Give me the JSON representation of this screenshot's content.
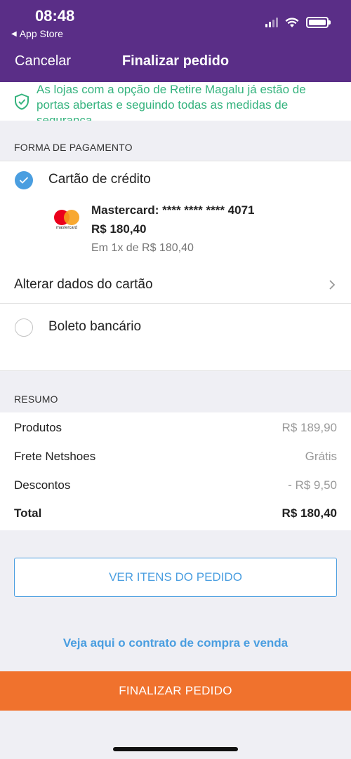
{
  "status_bar": {
    "time": "08:48",
    "back_app": "App Store"
  },
  "nav": {
    "cancel": "Cancelar",
    "title": "Finalizar pedido"
  },
  "banner": {
    "text": "As lojas com a opção de Retire Magalu já estão de portas abertas e seguindo todas as medidas de segurança"
  },
  "payment": {
    "section_label": "FORMA DE PAGAMENTO",
    "credit_option": "Cartão de crédito",
    "card_name": "Mastercard: **** **** **** 4071",
    "card_amount": "R$ 180,40",
    "installments": "Em 1x de R$ 180,40",
    "card_logo_text": "mastercard",
    "alter_card": "Alterar dados do cartão",
    "boleto_option": "Boleto bancário"
  },
  "summary": {
    "section_label": "RESUMO",
    "rows": [
      {
        "label": "Produtos",
        "value": "R$ 189,90"
      },
      {
        "label": "Frete Netshoes",
        "value": "Grátis"
      },
      {
        "label": "Descontos",
        "value": "- R$ 9,50"
      },
      {
        "label": "Total",
        "value": "R$ 180,40"
      }
    ]
  },
  "actions": {
    "view_items": "VER ITENS DO PEDIDO",
    "contract_link": "Veja aqui o contrato de compra e venda",
    "finish": "FINALIZAR PEDIDO"
  },
  "colors": {
    "header": "#5a2e87",
    "accent": "#4a9ee0",
    "finish": "#f0722d",
    "banner_text": "#35b37e"
  },
  "icons": [
    "signal-icon",
    "wifi-icon",
    "battery-icon",
    "shield-check-icon",
    "checkmark-icon",
    "mastercard-logo",
    "chevron-right-icon"
  ]
}
